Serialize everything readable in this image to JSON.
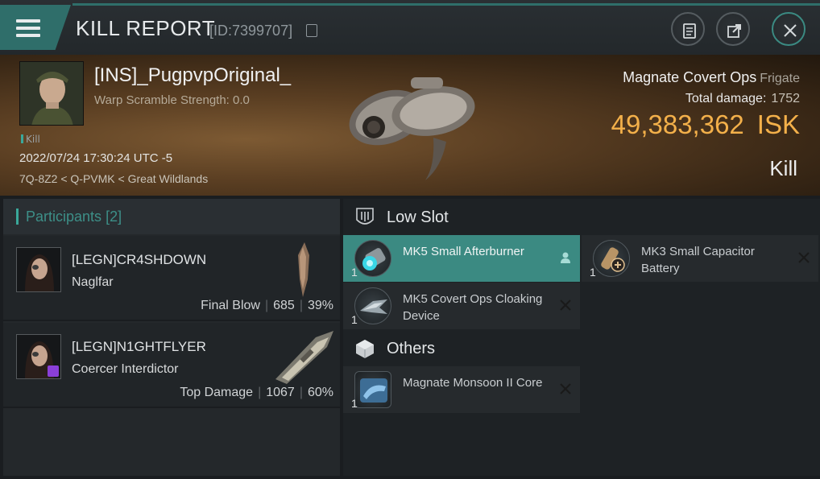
{
  "header": {
    "title": "KILL REPORT",
    "report_id": "[ID:7399707]"
  },
  "victim": {
    "pilot": "[INS]_PugpvpOriginal_",
    "warp_scramble": "Warp Scramble Strength: 0.0",
    "kill_tag": "Kill",
    "datetime": "2022/07/24 17:30:24 UTC -5",
    "location": "7Q-8Z2 < Q-PVMK < Great Wildlands",
    "ship": "Magnate Covert Ops",
    "ship_class": "Frigate",
    "total_damage_label": "Total damage:",
    "total_damage": "1752",
    "isk_value": "49,383,362",
    "isk_unit": "ISK",
    "result": "Kill"
  },
  "participants": {
    "title": "Participants",
    "count": "[2]",
    "items": [
      {
        "name": "[LEGN]CR4SHDOWN",
        "ship": "Naglfar",
        "role": "Final Blow",
        "damage": "685",
        "percent": "39%"
      },
      {
        "name": "[LEGN]N1GHTFLYER",
        "ship": "Coercer Interdictor",
        "role": "Top Damage",
        "damage": "1067",
        "percent": "60%"
      }
    ]
  },
  "fitting": {
    "low_slot_title": "Low Slot",
    "others_title": "Others",
    "low_slot": [
      {
        "qty": "1",
        "name": "MK5 Small Afterburner",
        "status": "dropped"
      },
      {
        "qty": "1",
        "name": "MK3 Small Capacitor Battery",
        "status": "destroyed"
      },
      {
        "qty": "1",
        "name": "MK5 Covert Ops Cloaking Device",
        "status": "destroyed"
      }
    ],
    "others": [
      {
        "qty": "1",
        "name": "Magnate Monsoon II Core",
        "status": "destroyed"
      }
    ]
  },
  "colors": {
    "accent_teal": "#3b8a82",
    "isk_gold": "#f3b04a"
  }
}
